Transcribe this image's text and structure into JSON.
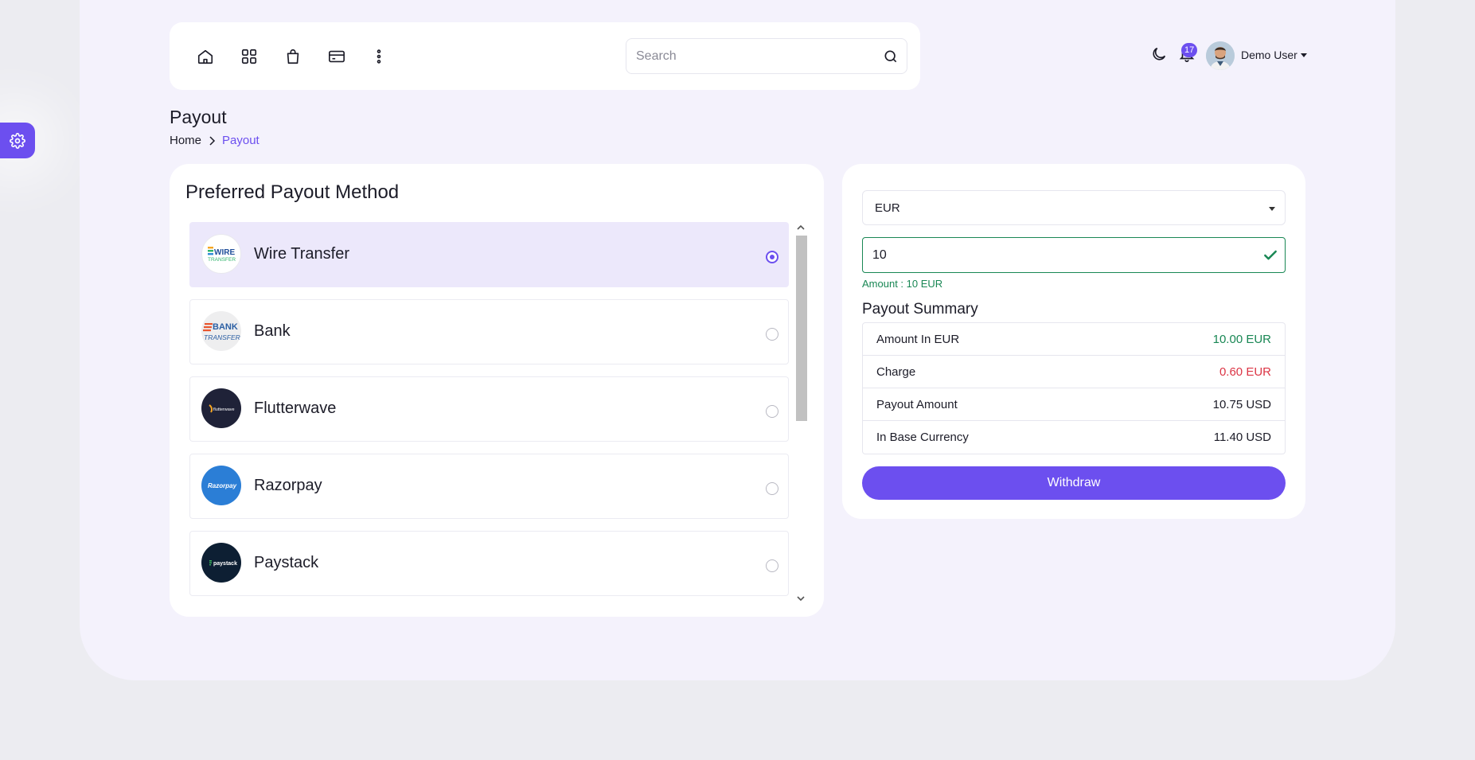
{
  "header": {
    "nav_icons": [
      "home-icon",
      "apps-grid-icon",
      "shopping-bag-icon",
      "credit-card-icon",
      "more-vertical-icon"
    ],
    "search_placeholder": "Search",
    "notification_count": "17",
    "user_name": "Demo User"
  },
  "page": {
    "title": "Payout",
    "breadcrumb": {
      "home": "Home",
      "current": "Payout"
    }
  },
  "methods": {
    "title": "Preferred Payout Method",
    "items": [
      {
        "name": "Wire Transfer",
        "logo_text": "WIRE",
        "logo_sub": "TRANSFER",
        "selected": true
      },
      {
        "name": "Bank",
        "logo_text": "BANK",
        "logo_sub": "TRANSFER",
        "selected": false
      },
      {
        "name": "Flutterwave",
        "logo_text": "flutterwave",
        "selected": false
      },
      {
        "name": "Razorpay",
        "logo_text": "Razorpay",
        "selected": false
      },
      {
        "name": "Paystack",
        "logo_text": "paystack",
        "selected": false
      }
    ]
  },
  "form": {
    "currency": "EUR",
    "amount_value": "10",
    "amount_hint": "Amount : 10 EUR",
    "summary_title": "Payout Summary",
    "rows": [
      {
        "label": "Amount In EUR",
        "value": "10.00 EUR",
        "color": "#198754"
      },
      {
        "label": "Charge",
        "value": "0.60 EUR",
        "color": "#dc3545"
      },
      {
        "label": "Payout Amount",
        "value": "10.75 USD",
        "color": "#1c1c28"
      },
      {
        "label": "In Base Currency",
        "value": "11.40 USD",
        "color": "#1c1c28"
      }
    ],
    "withdraw_label": "Withdraw"
  },
  "colors": {
    "accent": "#6c4fef",
    "success": "#198754",
    "danger": "#dc3545"
  }
}
